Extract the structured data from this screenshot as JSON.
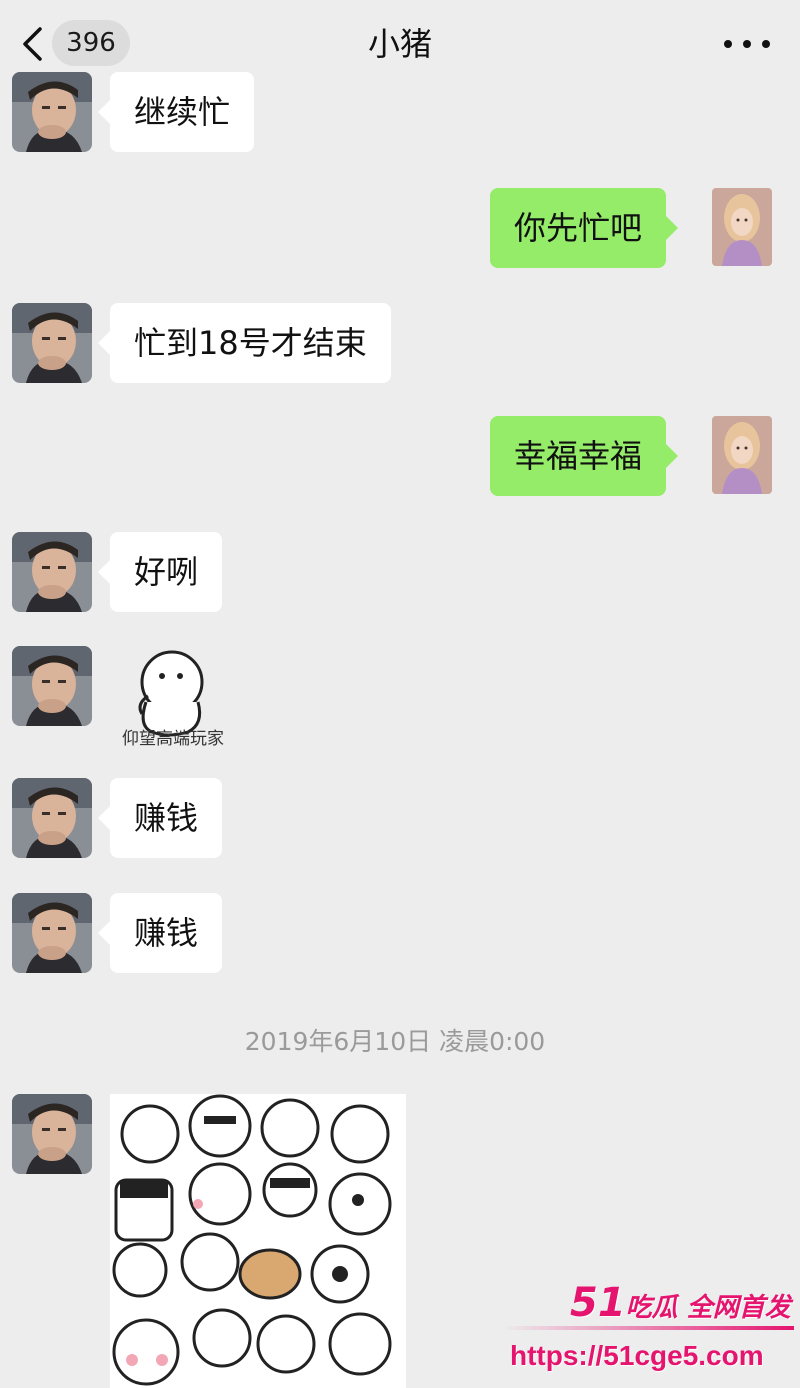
{
  "header": {
    "unread_count": "396",
    "title": "小猪"
  },
  "messages": [
    {
      "side": "in",
      "text": "继续忙"
    },
    {
      "side": "out",
      "text": "你先忙吧"
    },
    {
      "side": "in",
      "text": "忙到18号才结束"
    },
    {
      "side": "out",
      "text": "幸福幸福"
    },
    {
      "side": "in",
      "text": "好咧"
    },
    {
      "side": "in",
      "type": "sticker",
      "caption": "仰望高端玩家"
    },
    {
      "side": "in",
      "text": "赚钱"
    },
    {
      "side": "in",
      "text": "赚钱"
    },
    {
      "side": "in",
      "type": "sticker",
      "caption": ""
    }
  ],
  "timestamp": "2019年6月10日 凌晨0:00",
  "watermark": {
    "brand_number": "51",
    "brand_text": "吃瓜 全网首发",
    "url": "https://51cge5.com"
  },
  "colors": {
    "background": "#ededed",
    "incoming_bubble": "#ffffff",
    "outgoing_bubble": "#95ec69",
    "watermark": "#e5156f"
  },
  "icons": {
    "back": "chevron-left-icon",
    "more": "more-dots-icon"
  }
}
